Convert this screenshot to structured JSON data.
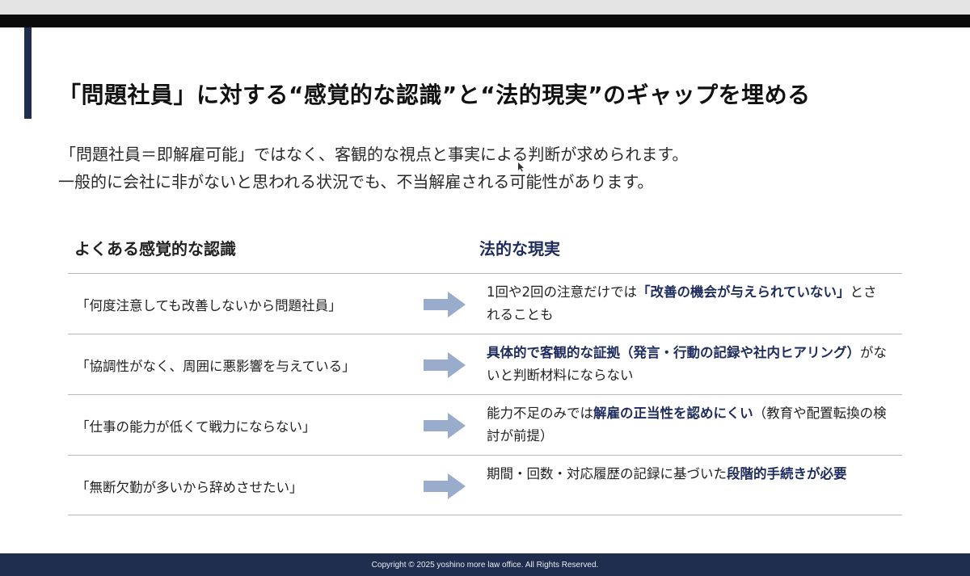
{
  "slide": {
    "title": "「問題社員」に対する“感覚的な認識”と“法的現実”のギャップを埋める",
    "intro_line1": "「問題社員＝即解雇可能」ではなく、客観的な視点と事実による判断が求められます。",
    "intro_line2": "一般的に会社に非がないと思われる状況でも、不当解雇される可能性があります。"
  },
  "table": {
    "left_header": "よくある感覚的な認識",
    "right_header": "法的な現実",
    "rows": [
      {
        "perception": "「何度注意しても改善しないから問題社員」",
        "reality_pre": "1回や2回の注意だけでは",
        "reality_hl": "「改善の機会が与えられていない」",
        "reality_post": "とされることも"
      },
      {
        "perception": "「協調性がなく、周囲に悪影響を与えている」",
        "reality_pre": "",
        "reality_hl": "具体的で客観的な証拠（発言・行動の記録や社内ヒアリング）",
        "reality_post": "がないと判断材料にならない"
      },
      {
        "perception": "「仕事の能力が低くて戦力にならない」",
        "reality_pre": "能力不足のみでは",
        "reality_hl": "解雇の正当性を認めにくい",
        "reality_post": "（教育や配置転換の検討が前提）"
      },
      {
        "perception": "「無断欠勤が多いから辞めさせたい」",
        "reality_pre": "期間・回数・対応履歴の記録に基づいた",
        "reality_hl": "段階的手続きが必要",
        "reality_post": ""
      }
    ]
  },
  "footer": {
    "copyright": "Copyright © 2025 yoshino more law office. All Rights Reserved."
  },
  "colors": {
    "accent_navy": "#1f2d4e",
    "highlight_navy": "#1f2d5e",
    "arrow_blue": "#9aaccb"
  }
}
